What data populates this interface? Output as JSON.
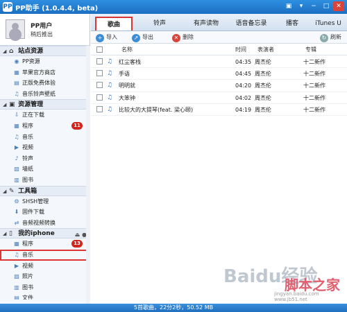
{
  "window": {
    "title": "PP助手 (1.0.4.4, beta)",
    "icon_text": "PP"
  },
  "user": {
    "name": "PP用户",
    "logout": "稍后推出"
  },
  "sidebar": {
    "sections": [
      {
        "title": "站点资源",
        "icon": "home-icon",
        "items": [
          {
            "label": "PP资源",
            "icon": "pp-icon"
          },
          {
            "label": "苹果官方商店",
            "icon": "store-icon"
          },
          {
            "label": "正版免费体验",
            "icon": "gift-icon"
          },
          {
            "label": "音乐铃声壁纸",
            "icon": "music-icon"
          }
        ]
      },
      {
        "title": "资源管理",
        "icon": "folder-icon",
        "items": [
          {
            "label": "正在下载",
            "icon": "download-icon"
          },
          {
            "label": "程序",
            "icon": "app-icon",
            "badge": "11"
          },
          {
            "label": "音乐",
            "icon": "music-icon"
          },
          {
            "label": "视频",
            "icon": "video-icon"
          },
          {
            "label": "铃声",
            "icon": "bell-icon"
          },
          {
            "label": "墙纸",
            "icon": "wallpaper-icon"
          },
          {
            "label": "图书",
            "icon": "book-icon"
          }
        ]
      },
      {
        "title": "工具箱",
        "icon": "tools-icon",
        "items": [
          {
            "label": "SHSH管理",
            "icon": "shsh-icon"
          },
          {
            "label": "固件下载",
            "icon": "firmware-icon"
          },
          {
            "label": "音频视频转换",
            "icon": "convert-icon"
          }
        ]
      },
      {
        "title": "我的iphone",
        "icon": "phone-icon",
        "items": [
          {
            "label": "程序",
            "icon": "app-icon",
            "badge": "13"
          },
          {
            "label": "音乐",
            "icon": "music-icon",
            "selected": true
          },
          {
            "label": "视频",
            "icon": "video-icon"
          },
          {
            "label": "照片",
            "icon": "photo-icon"
          },
          {
            "label": "图书",
            "icon": "book-icon"
          },
          {
            "label": "文件",
            "icon": "file-icon"
          }
        ]
      }
    ]
  },
  "tabs": [
    {
      "label": "歌曲",
      "active": true
    },
    {
      "label": "铃声"
    },
    {
      "label": "有声读物"
    },
    {
      "label": "语音备忘录"
    },
    {
      "label": "播客"
    },
    {
      "label": "iTunes U"
    }
  ],
  "toolbar": {
    "import": "导入",
    "export": "导出",
    "delete": "删除",
    "refresh": "刷新"
  },
  "table": {
    "headers": {
      "name": "名称",
      "time": "时间",
      "artist": "表演者",
      "album": "专辑"
    },
    "rows": [
      {
        "name": "红尘客栈",
        "time": "04:35",
        "artist": "周杰伦",
        "album": "十二新作"
      },
      {
        "name": "手语",
        "time": "04:45",
        "artist": "周杰伦",
        "album": "十二新作"
      },
      {
        "name": "明明就",
        "time": "04:20",
        "artist": "周杰伦",
        "album": "十二新作"
      },
      {
        "name": "大笨钟",
        "time": "04:02",
        "artist": "周杰伦",
        "album": "十二新作"
      },
      {
        "name": "比较大的大提琴(feat. 梁心颐)",
        "time": "04:19",
        "artist": "周杰伦",
        "album": "十二新作"
      }
    ]
  },
  "status": "5首歌曲，22分2秒，50.52 MB",
  "watermark": {
    "text": "Baidu经验",
    "site": "脚本之家",
    "url": "jingyan.baidu.com  www.jb51.net"
  }
}
